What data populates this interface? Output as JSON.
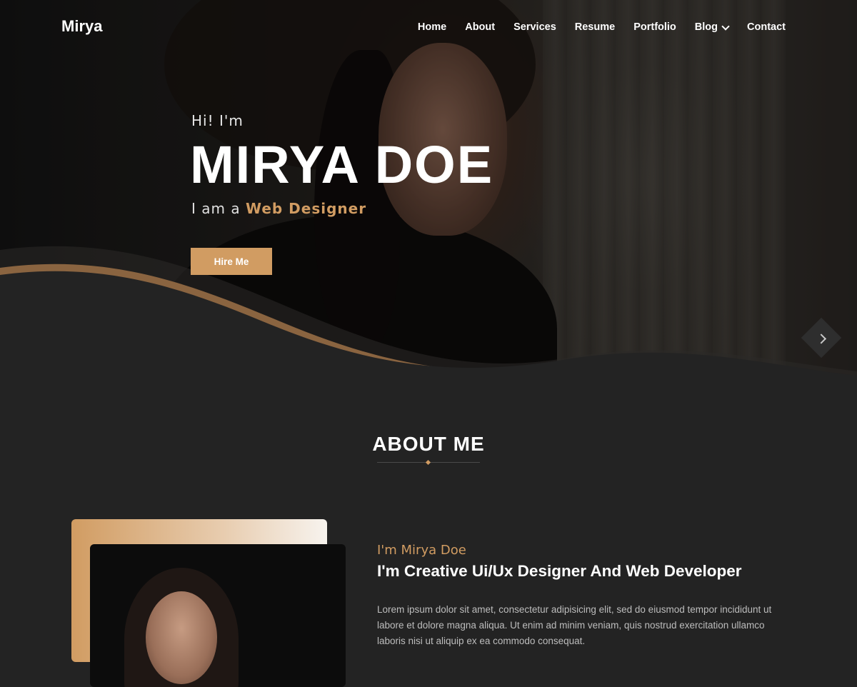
{
  "header": {
    "logo": "Mirya",
    "nav": [
      {
        "label": "Home"
      },
      {
        "label": "About"
      },
      {
        "label": "Services"
      },
      {
        "label": "Resume"
      },
      {
        "label": "Portfolio"
      },
      {
        "label": "Blog",
        "has_dropdown": true
      },
      {
        "label": "Contact"
      }
    ]
  },
  "hero": {
    "greeting": "Hi! I'm",
    "name": "MIRYA DOE",
    "role_prefix": "I am a ",
    "role_highlight": "Web Designer",
    "hire_button": "Hire Me",
    "scroll_icon": "chevron-down-icon"
  },
  "about": {
    "section_title": "ABOUT ME",
    "intro": "I'm Mirya Doe",
    "headline": "I'm Creative Ui/Ux Designer And Web Developer",
    "paragraph": "Lorem ipsum dolor sit amet, consectetur adipisicing elit, sed do eiusmod tempor incididunt ut labore et dolore magna aliqua. Ut enim ad minim veniam, quis nostrud exercitation ullamco laboris nisi ut aliquip ex ea commodo consequat."
  },
  "colors": {
    "accent": "#d19c62",
    "background": "#232323",
    "text": "#ffffff"
  }
}
